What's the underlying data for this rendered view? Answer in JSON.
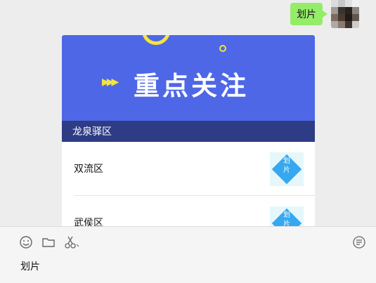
{
  "chat": {
    "sent_message": "划片"
  },
  "card": {
    "banner_title": "重点关注",
    "banner_caption": "龙泉驿区",
    "items": [
      {
        "label": "双流区",
        "thumb_text": "划\n片"
      },
      {
        "label": "武侯区",
        "thumb_text": "划\n片"
      }
    ]
  },
  "toolbar": {
    "emoji_icon": "emoji-icon",
    "folder_icon": "folder-icon",
    "scissors_icon": "scissors-icon",
    "history_icon": "chat-history-icon"
  },
  "input": {
    "draft_text": "划片"
  },
  "colors": {
    "bubble": "#95ec69",
    "banner": "#4e67e6",
    "accent_yellow": "#f5e43a",
    "thumb_blue": "#36a8f0"
  }
}
